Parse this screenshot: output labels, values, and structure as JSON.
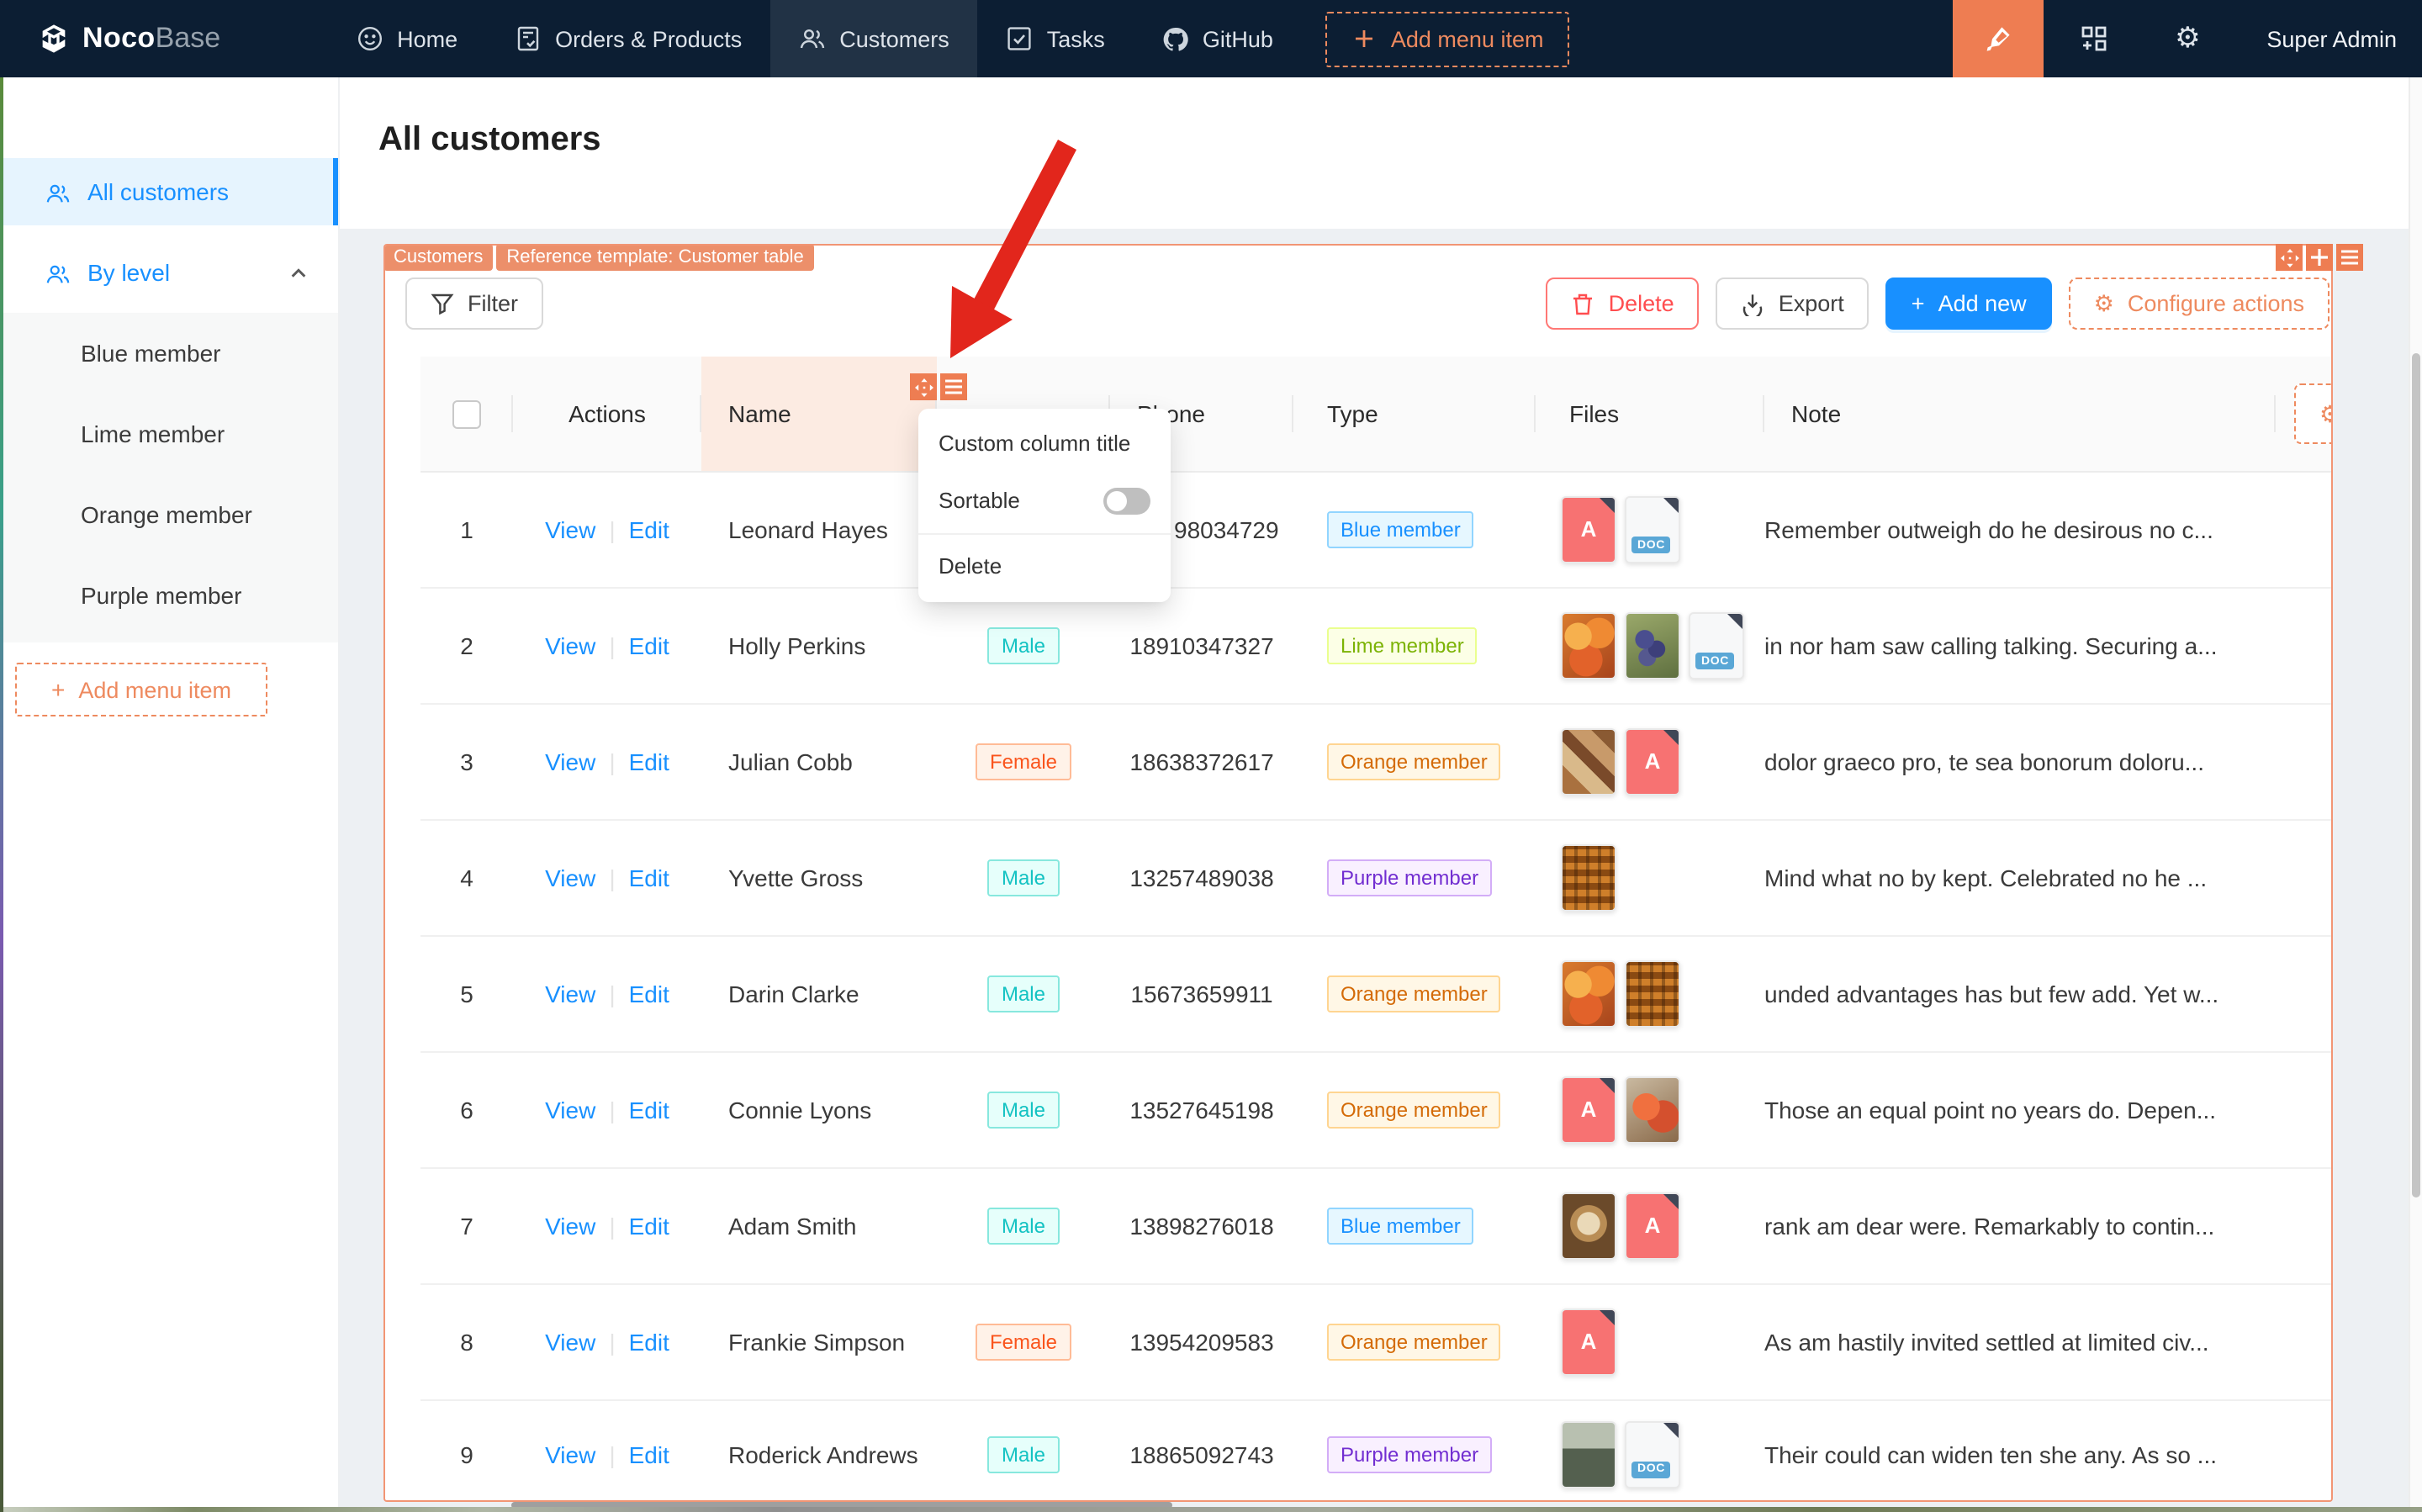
{
  "navbar": {
    "logo": {
      "bold": "Noco",
      "light": "Base"
    },
    "items": [
      {
        "label": "Home",
        "icon": "smile-icon"
      },
      {
        "label": "Orders & Products",
        "icon": "file-check-icon"
      },
      {
        "label": "Customers",
        "icon": "team-icon",
        "active": true
      },
      {
        "label": "Tasks",
        "icon": "check-square-icon"
      },
      {
        "label": "GitHub",
        "icon": "github-icon"
      },
      {
        "label": "Add menu item",
        "icon": "plus-icon",
        "style": "dashed"
      }
    ],
    "right": {
      "user": "Super Admin"
    }
  },
  "sidebar": {
    "items": [
      {
        "label": "All customers",
        "icon": "team-icon",
        "active": true
      },
      {
        "label": "By level",
        "icon": "team-icon",
        "caret": "up"
      }
    ],
    "sub_items": [
      "Blue member",
      "Lime member",
      "Orange member",
      "Purple member"
    ],
    "add_label": "Add menu item"
  },
  "page": {
    "title": "All customers"
  },
  "block": {
    "tags": [
      "Customers",
      "Reference template: Customer table"
    ],
    "filter_label": "Filter",
    "delete_label": "Delete",
    "export_label": "Export",
    "add_new_label": "Add new",
    "configure_actions_label": "Configure actions"
  },
  "dropdown": {
    "items": [
      {
        "label": "Custom column title"
      },
      {
        "label": "Sortable",
        "toggle": "off"
      },
      {
        "label": "Delete",
        "divider_before": true
      }
    ]
  },
  "table": {
    "columns": [
      {
        "key": "index",
        "label": ""
      },
      {
        "key": "actions",
        "label": "Actions"
      },
      {
        "key": "name",
        "label": "Name",
        "highlighted": true
      },
      {
        "key": "gender",
        "label": ""
      },
      {
        "key": "phone",
        "label": "Phone"
      },
      {
        "key": "type",
        "label": "Type"
      },
      {
        "key": "files",
        "label": "Files"
      },
      {
        "key": "note",
        "label": "Note"
      },
      {
        "key": "extra",
        "label": ""
      }
    ],
    "row_actions": [
      "View",
      "Edit"
    ],
    "rows": [
      {
        "index": 1,
        "name": "Leonard Hayes",
        "gender": "",
        "phone": "98034729",
        "type": "Blue member",
        "files": [
          "pdf",
          "doc"
        ],
        "note": "Remember outweigh do he desirous no c..."
      },
      {
        "index": 2,
        "name": "Holly Perkins",
        "gender": "Male",
        "phone": "18910347327",
        "type": "Lime member",
        "files": [
          "img-oranges",
          "img-grapes",
          "doc"
        ],
        "note": "in nor ham saw calling talking. Securing a..."
      },
      {
        "index": 3,
        "name": "Julian Cobb",
        "gender": "Female",
        "phone": "18638372617",
        "type": "Orange member",
        "files": [
          "img-food",
          "pdf"
        ],
        "note": "dolor graeco pro, te sea bonorum doloru..."
      },
      {
        "index": 4,
        "name": "Yvette Gross",
        "gender": "Male",
        "phone": "13257489038",
        "type": "Purple member",
        "files": [
          "img-trays"
        ],
        "note": "Mind what no by kept. Celebrated no he ..."
      },
      {
        "index": 5,
        "name": "Darin Clarke",
        "gender": "Male",
        "phone": "15673659911",
        "type": "Orange member",
        "files": [
          "img-oranges",
          "img-trays"
        ],
        "note": "unded advantages has but few add. Yet w..."
      },
      {
        "index": 6,
        "name": "Connie Lyons",
        "gender": "Male",
        "phone": "13527645198",
        "type": "Orange member",
        "files": [
          "pdf",
          "img-pomegranate"
        ],
        "note": "Those an equal point no years do. Depen..."
      },
      {
        "index": 7,
        "name": "Adam Smith",
        "gender": "Male",
        "phone": "13898276018",
        "type": "Blue member",
        "files": [
          "img-coffee",
          "pdf"
        ],
        "note": "rank am dear were. Remarkably to contin..."
      },
      {
        "index": 8,
        "name": "Frankie Simpson",
        "gender": "Female",
        "phone": "13954209583",
        "type": "Orange member",
        "files": [
          "pdf"
        ],
        "note": "As am hastily invited settled at limited civ..."
      },
      {
        "index": 9,
        "name": "Roderick Andrews",
        "gender": "Male",
        "phone": "18865092743",
        "type": "Purple member",
        "files": [
          "img-storefront",
          "doc"
        ],
        "note": "Their could can widen ten she any. As so ..."
      }
    ]
  },
  "colors": {
    "navbar_bg": "#0c1e33",
    "accent_orange": "#ee7d52",
    "primary_blue": "#1890ff",
    "danger_red": "#ff4d4f",
    "arrow_red": "#e2261c"
  }
}
